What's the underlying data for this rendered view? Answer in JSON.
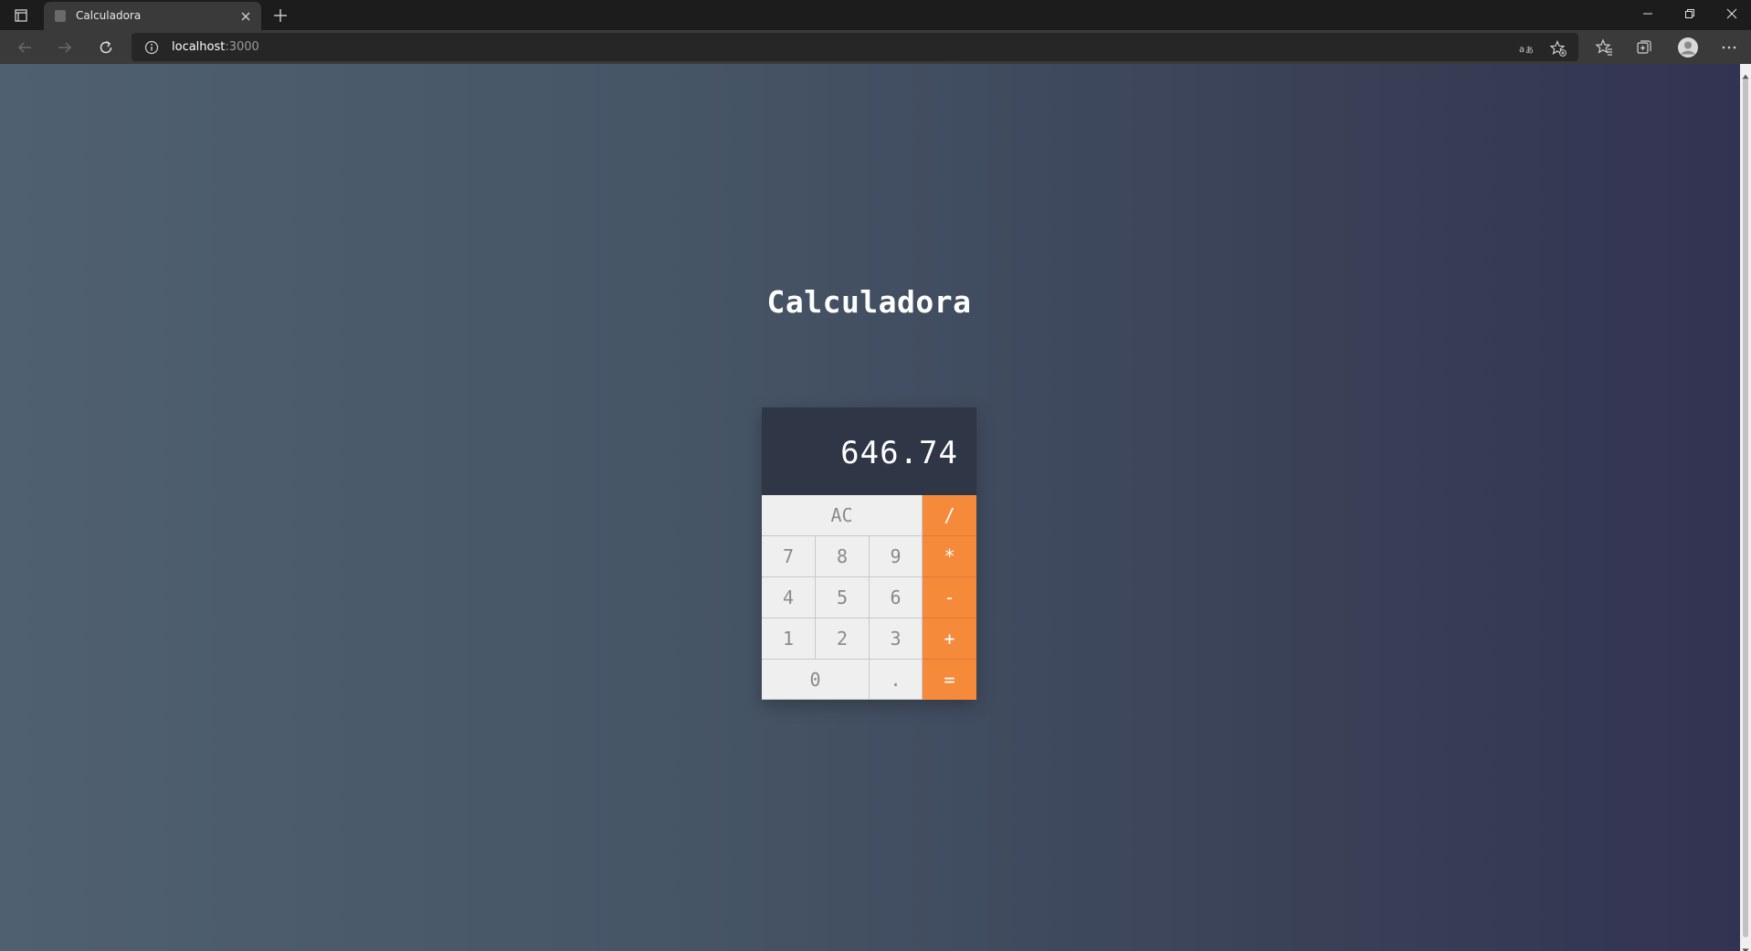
{
  "browser": {
    "tab_title": "Calculadora",
    "url_host": "localhost",
    "url_port": ":3000"
  },
  "page": {
    "heading": "Calculadora",
    "display_value": "646.74"
  },
  "keypad": {
    "clear": "AC",
    "divide": "/",
    "multiply": "*",
    "subtract": "-",
    "add": "+",
    "equals": "=",
    "decimal": ".",
    "digits": [
      "0",
      "1",
      "2",
      "3",
      "4",
      "5",
      "6",
      "7",
      "8",
      "9"
    ]
  },
  "colors": {
    "operator": "#f58a3b",
    "display_bg": "#2f3747",
    "key_bg": "#efefef"
  }
}
